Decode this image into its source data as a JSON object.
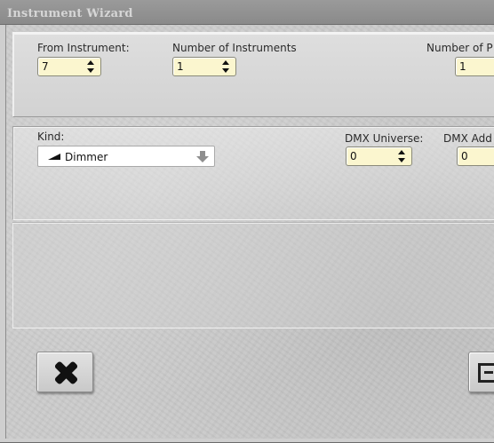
{
  "window": {
    "title": "Instrument Wizard"
  },
  "range": {
    "from_label": "From Instrument:",
    "from_value": "7",
    "count_label": "Number of Instruments",
    "count_value": "1",
    "parts_label": "Number of P",
    "parts_value": "1"
  },
  "patch": {
    "kind_label": "Kind:",
    "kind_value": "Dimmer",
    "kind_icon": "dimmer-ramp-icon",
    "universe_label": "DMX Universe:",
    "universe_value": "0",
    "address_label": "DMX Add",
    "address_value": "0"
  },
  "buttons": {
    "cancel_icon": "close-icon",
    "ok_icon": "confirm-icon"
  },
  "colors": {
    "field_bg": "#fbf6cf",
    "titlebar": "#8f8f8f",
    "title_text": "#d6d6d6",
    "background": "#cbcbcb"
  }
}
